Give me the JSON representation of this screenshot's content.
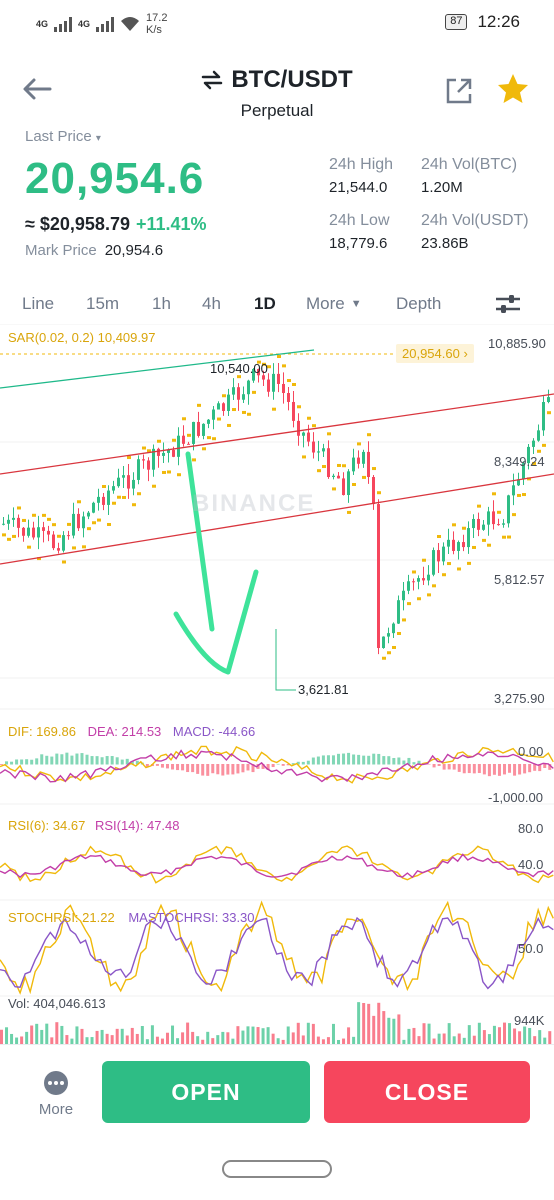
{
  "status": {
    "net1": "4G",
    "net2": "4G",
    "speed": "17.2",
    "speed_unit": "K/s",
    "battery": "87",
    "time": "12:26"
  },
  "header": {
    "pair": "BTC/USDT",
    "contract": "Perpetual",
    "icons": [
      "back-arrow-icon",
      "swap-icon",
      "share-icon",
      "star-icon"
    ]
  },
  "price": {
    "last_label": "Last Price",
    "last": "20,954.6",
    "fiat": "≈ $20,958.79",
    "change": "+11.41%",
    "mark_label": "Mark Price",
    "mark": "20,954.6"
  },
  "stats": {
    "high_label": "24h High",
    "high": "21,544.0",
    "low_label": "24h Low",
    "low": "18,779.6",
    "vol_btc_label": "24h Vol(BTC)",
    "vol_btc": "1.20M",
    "vol_usdt_label": "24h Vol(USDT)",
    "vol_usdt": "23.86B"
  },
  "tabs": {
    "line": "Line",
    "m15": "15m",
    "h1": "1h",
    "h4": "4h",
    "d1": "1D",
    "more": "More",
    "depth": "Depth",
    "active": "1D"
  },
  "chart": {
    "sar_label": "SAR(0.02, 0.2)",
    "sar_value": "10,409.97",
    "axis": [
      "10,885.90",
      "8,349.24",
      "5,812.57",
      "3,275.90"
    ],
    "current_tag": "20,954.60",
    "high_mark": "10,540.00",
    "low_mark": "3,621.81",
    "watermark": "BINANCE",
    "macd": {
      "dif_label": "DIF: 169.86",
      "dea_label": "DEA: 214.53",
      "macd_label": "MACD: -44.66",
      "axis_top": "0.00",
      "axis_bottom": "-1,000.00"
    },
    "rsi": {
      "rsi6_label": "RSI(6): 34.67",
      "rsi14_label": "RSI(14): 47.48",
      "axis_top": "80.0",
      "axis_bottom": "40.0"
    },
    "stoch": {
      "stoch_label": "STOCHRSI: 21.22",
      "ma_label": "MASTOCHRSI: 33.30",
      "axis": "50.0"
    },
    "vol": {
      "vol_label": "Vol: 404,046.613",
      "axis": "944K"
    },
    "colors": {
      "up": "#2ebd85",
      "down": "#f6465d",
      "sar": "#f0b90b",
      "channel": "#d9363e",
      "upper_line": "#1fb98a"
    }
  },
  "actions": {
    "more": "More",
    "open": "OPEN",
    "close": "CLOSE"
  }
}
